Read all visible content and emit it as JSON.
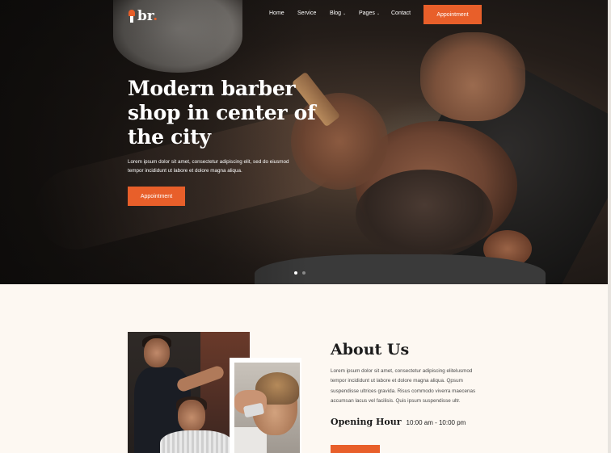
{
  "brand": {
    "logo_text": "br",
    "logo_dot": "."
  },
  "nav": {
    "items": [
      {
        "label": "Home",
        "has_dropdown": false
      },
      {
        "label": "Service",
        "has_dropdown": false
      },
      {
        "label": "Blog",
        "has_dropdown": true
      },
      {
        "label": "Pages",
        "has_dropdown": true
      },
      {
        "label": "Contact",
        "has_dropdown": false
      }
    ],
    "appointment_label": "Appointment"
  },
  "hero": {
    "title": "Modern barber shop in center of the city",
    "text": "Lorem ipsum dolor sit amet, consectetur adipiscing elit, sed do eiusmod tempor incididunt ut labore et dolore magna aliqua.",
    "button_label": "Appointment",
    "slider": {
      "count": 2,
      "active": 1
    }
  },
  "about": {
    "title": "About Us",
    "text": "Lorem ipsum dolor sit amet, consectetur adipiscing elitelusmod tempor incididunt ut labore et dolore magna aliqua. Qpsum suspendisse ultrices gravida. Risus commodo viverra maecenas accumsan lacus vel facilisis. Quis ipsum suspendisse ultr.",
    "hours_label": "Opening Hour",
    "hours_value": "10:00 am - 10:00 pm"
  },
  "colors": {
    "accent": "#e85f2a",
    "hero_bg": "#1c1714",
    "section_bg": "#fdf8f2",
    "text_dark": "#1c1c1c"
  },
  "icons": {
    "logo": "barber-brush-icon",
    "dropdown": "chevron-down-icon"
  }
}
